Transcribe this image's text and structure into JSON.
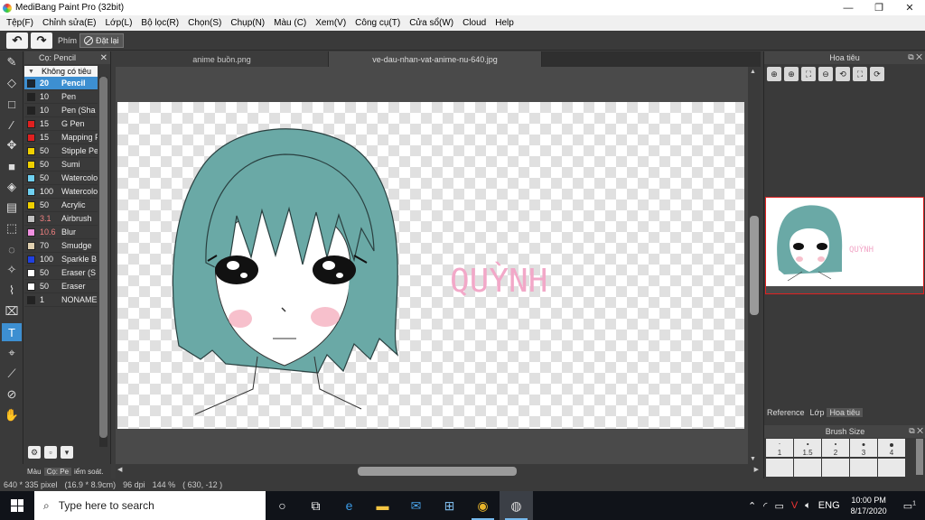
{
  "window": {
    "title": "MediBang Paint Pro (32bit)",
    "minimize": "—",
    "maximize": "❐",
    "close": "✕"
  },
  "menu": [
    "Tệp(F)",
    "Chỉnh sửa(E)",
    "Lớp(L)",
    "Bộ lọc(R)",
    "Chọn(S)",
    "Chụp(N)",
    "Màu (C)",
    "Xem(V)",
    "Công cụ(T)",
    "Cửa sổ(W)",
    "Cloud",
    "Help"
  ],
  "toolbar": {
    "undo_icon": "↶",
    "redo_icon": "↷",
    "hotkey_label": "Phím",
    "reset_label": "Đặt lại"
  },
  "brush_panel": {
    "title": "Cọ: Pencil",
    "close": "✕",
    "group": "Không có tiêu",
    "brushes": [
      {
        "size": "20",
        "name": "Pencil",
        "color": "#1a2733",
        "selected": true,
        "size_color": "#ffffff"
      },
      {
        "size": "10",
        "name": "Pen",
        "color": "#222222",
        "selected": false,
        "size_color": "#eeeeee"
      },
      {
        "size": "10",
        "name": "Pen (Sha",
        "color": "#222222",
        "selected": false,
        "size_color": "#eeeeee"
      },
      {
        "size": "15",
        "name": "G Pen",
        "color": "#e02020",
        "selected": false,
        "size_color": "#eeeeee"
      },
      {
        "size": "15",
        "name": "Mapping P",
        "color": "#e02020",
        "selected": false,
        "size_color": "#eeeeee"
      },
      {
        "size": "50",
        "name": "Stipple Pe",
        "color": "#f0d000",
        "selected": false,
        "size_color": "#eeeeee"
      },
      {
        "size": "50",
        "name": "Sumi",
        "color": "#f0d000",
        "selected": false,
        "size_color": "#eeeeee"
      },
      {
        "size": "50",
        "name": "Watercolo",
        "color": "#6fd0f0",
        "selected": false,
        "size_color": "#eeeeee"
      },
      {
        "size": "100",
        "name": "Watercolo",
        "color": "#6fd0f0",
        "selected": false,
        "size_color": "#eeeeee"
      },
      {
        "size": "50",
        "name": "Acrylic",
        "color": "#f0d000",
        "selected": false,
        "size_color": "#eeeeee"
      },
      {
        "size": "3.1",
        "name": "Airbrush",
        "color": "#c0c0c0",
        "selected": false,
        "size_color": "#f08080"
      },
      {
        "size": "10.6",
        "name": "Blur",
        "color": "#f090e0",
        "selected": false,
        "size_color": "#f08080"
      },
      {
        "size": "70",
        "name": "Smudge",
        "color": "#e0d0b0",
        "selected": false,
        "size_color": "#eeeeee"
      },
      {
        "size": "100",
        "name": "Sparkle B",
        "color": "#2040e0",
        "selected": false,
        "size_color": "#eeeeee"
      },
      {
        "size": "50",
        "name": "Eraser (S",
        "color": "#ffffff",
        "selected": false,
        "size_color": "#eeeeee"
      },
      {
        "size": "50",
        "name": "Eraser",
        "color": "#ffffff",
        "selected": false,
        "size_color": "#eeeeee"
      },
      {
        "size": "1",
        "name": "NONAME",
        "color": "#222222",
        "selected": false,
        "size_color": "#eeeeee"
      }
    ],
    "bottom_tabs": [
      "Màu",
      "Cọ: Pe",
      "iểm soát."
    ]
  },
  "doc_tabs": [
    {
      "label": "anime buồn.png",
      "active": false
    },
    {
      "label": "ve-dau-nhan-vat-anime-nu-640.jpg",
      "active": true
    }
  ],
  "canvas": {
    "text": "QUỲNH",
    "hair": "#6aa9a6",
    "text_color": "#f2a8c8"
  },
  "navigator": {
    "title": "Hoa tiêu",
    "tools": [
      "⊕",
      "⊕",
      "⛶",
      "⊖",
      "⟲",
      "⛶",
      "⟳"
    ],
    "thumb_text": "QUỲNH"
  },
  "right_tabs": [
    "Reference",
    "Lớp",
    "Hoa tiêu"
  ],
  "brush_size": {
    "title": "Brush Size",
    "sizes": [
      "1",
      "1.5",
      "2",
      "3",
      "4"
    ]
  },
  "status": {
    "dims": "640 * 335 pixel",
    "cm": "(16.9 * 8.9cm)",
    "dpi": "96 dpi",
    "zoom": "144 %",
    "coords": "( 630, -12 )"
  },
  "taskbar": {
    "search_placeholder": "Type here to search",
    "lang": "ENG",
    "time": "10:00 PM",
    "date": "8/17/2020",
    "notif": "1"
  }
}
